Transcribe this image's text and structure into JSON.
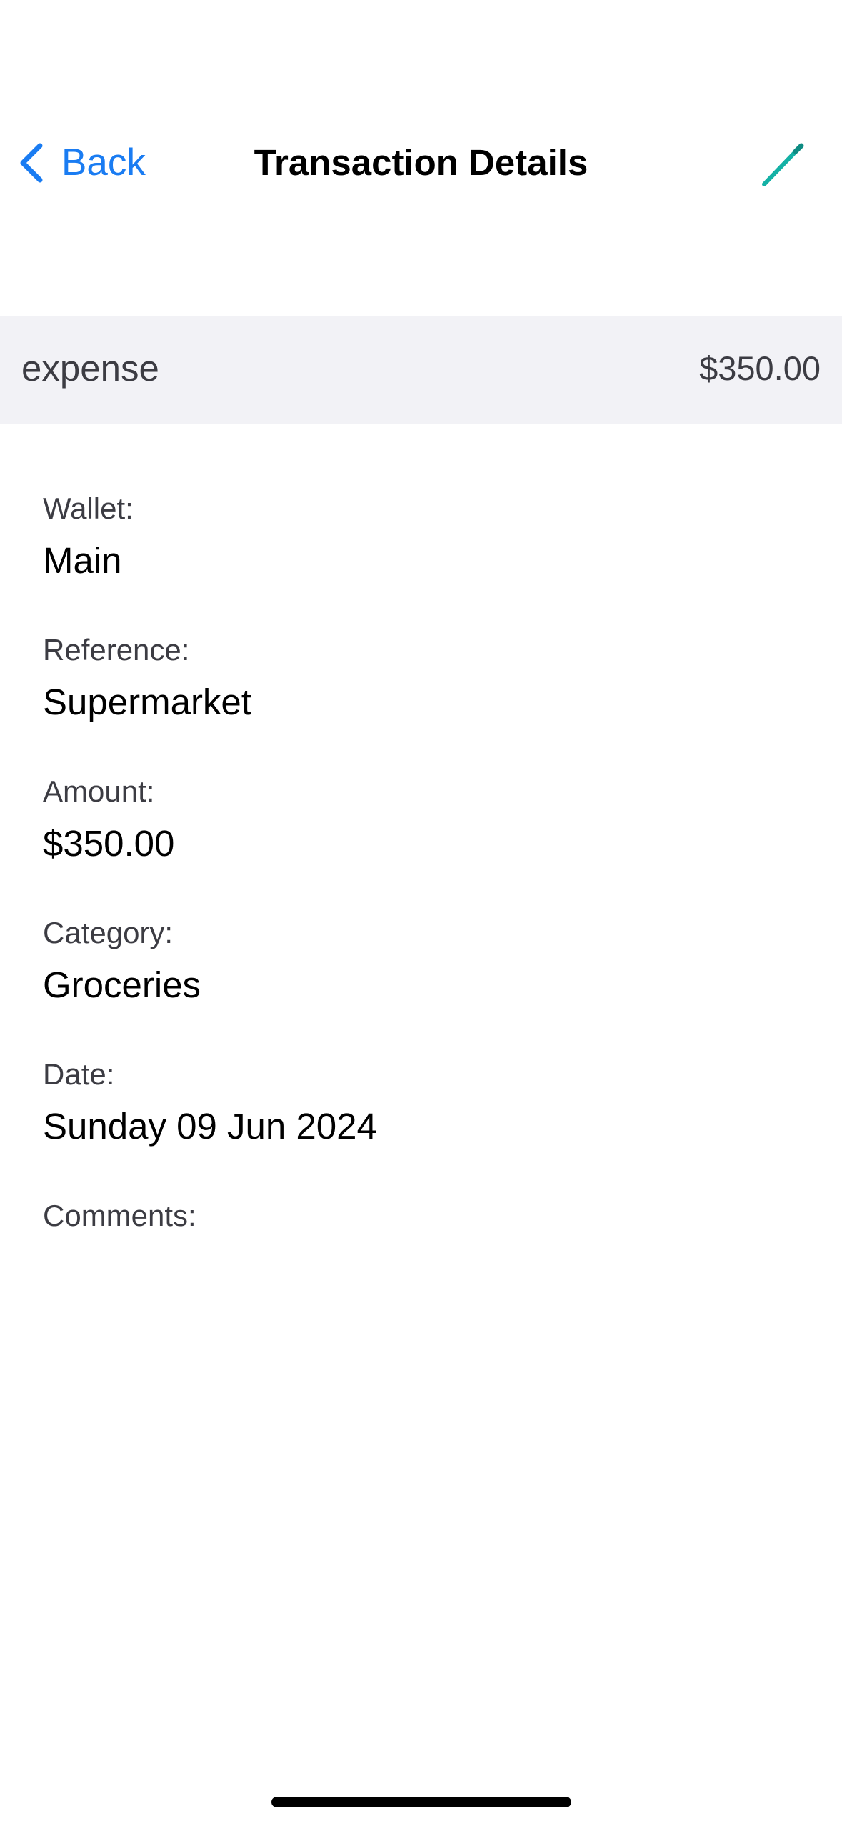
{
  "nav": {
    "back_label": "Back",
    "title": "Transaction Details",
    "edit_icon": "pencil-icon",
    "back_icon": "chevron-left-icon"
  },
  "summary": {
    "type": "expense",
    "amount": "$350.00"
  },
  "fields": [
    {
      "label": "Wallet:",
      "value": "Main"
    },
    {
      "label": "Reference:",
      "value": "Supermarket"
    },
    {
      "label": "Amount:",
      "value": "$350.00"
    },
    {
      "label": "Category:",
      "value": "Groceries"
    },
    {
      "label": "Date:",
      "value": "Sunday 09 Jun 2024"
    },
    {
      "label": "Comments:",
      "value": ""
    }
  ],
  "colors": {
    "accent_blue": "#1a7cf2",
    "edit_teal": "#14b1a5",
    "band_gray": "#f2f2f6"
  }
}
